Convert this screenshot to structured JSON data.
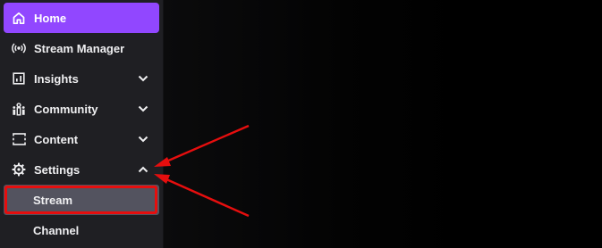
{
  "sidebar": {
    "items": [
      {
        "label": "Home",
        "icon": "home-icon",
        "active": true
      },
      {
        "label": "Stream Manager",
        "icon": "broadcast-icon"
      },
      {
        "label": "Insights",
        "icon": "insights-icon",
        "expand": "chevron-down-icon"
      },
      {
        "label": "Community",
        "icon": "community-icon",
        "expand": "chevron-down-icon"
      },
      {
        "label": "Content",
        "icon": "content-icon",
        "expand": "chevron-down-icon"
      },
      {
        "label": "Settings",
        "icon": "gear-icon",
        "expand": "chevron-up-icon",
        "expanded": true
      }
    ],
    "subitems": [
      {
        "label": "Stream",
        "selected": true
      },
      {
        "label": "Channel"
      }
    ]
  },
  "colors": {
    "accent": "#9147ff",
    "sidebar_bg": "#1f1f23",
    "selected_bg": "#53535f",
    "annotation": "#e60e0e"
  }
}
